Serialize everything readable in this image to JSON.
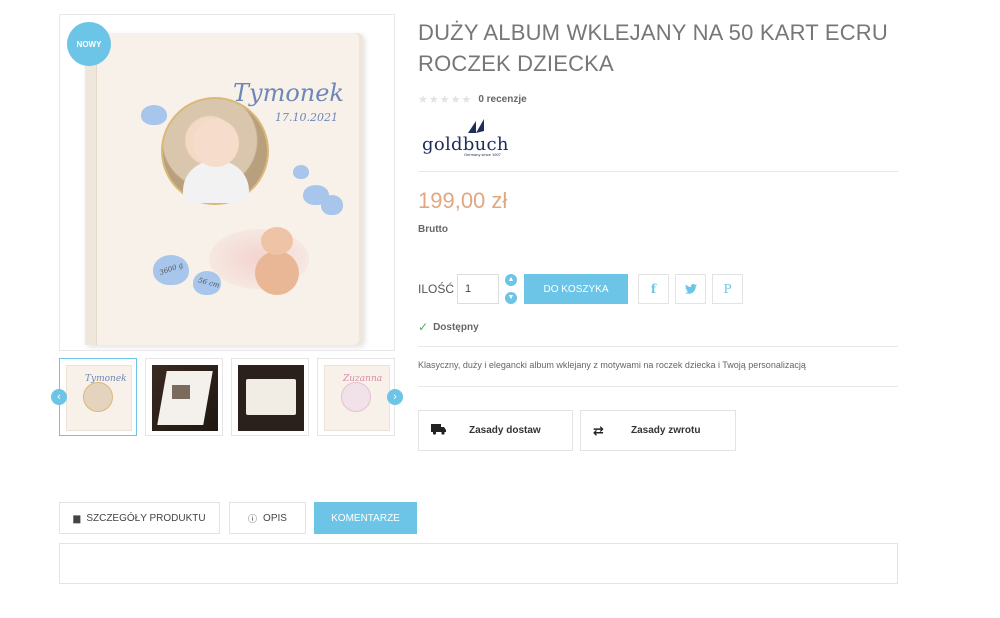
{
  "product": {
    "badge": "NOWY",
    "title": "DUŻY ALBUM WKLEJANY NA 50 KART ECRU ROCZEK DZIECKA",
    "rating": {
      "stars": 0,
      "max_stars": 5,
      "reviews_label": "0 recenzje"
    },
    "brand": {
      "name": "goldbuch",
      "tagline": "Germany since 1907"
    },
    "price": "199,00 zł",
    "price_note": "Brutto",
    "availability": "Dostępny",
    "description": "Klasyczny, duży i elegancki album wklejany z motywami na roczek dziecka i Twoją personalizacją"
  },
  "image": {
    "album_name": "Tymonek",
    "album_date": "17.10.2021",
    "weight_label": "3600 g",
    "length_label": "56 cm",
    "thumb4_name": "Zuzanna"
  },
  "cart": {
    "quantity_label": "ILOŚĆ",
    "quantity_value": "1",
    "add_to_cart": "DO KOSZYKA"
  },
  "share": {
    "facebook": "f",
    "twitter": "🐦",
    "pinterest": "P"
  },
  "policies": [
    {
      "label": "Zasady dostaw",
      "icon": "truck-icon"
    },
    {
      "label": "Zasady zwrotu",
      "icon": "exchange-icon"
    }
  ],
  "tabs": [
    {
      "label": "SZCZEGÓŁY PRODUKTU",
      "icon": "document-icon"
    },
    {
      "label": "OPIS",
      "icon": "info-icon"
    },
    {
      "label": "KOMENTARZE",
      "active": true
    }
  ],
  "colors": {
    "accent": "#6cc4e6",
    "price": "#e0a882",
    "available": "#4caf50"
  }
}
